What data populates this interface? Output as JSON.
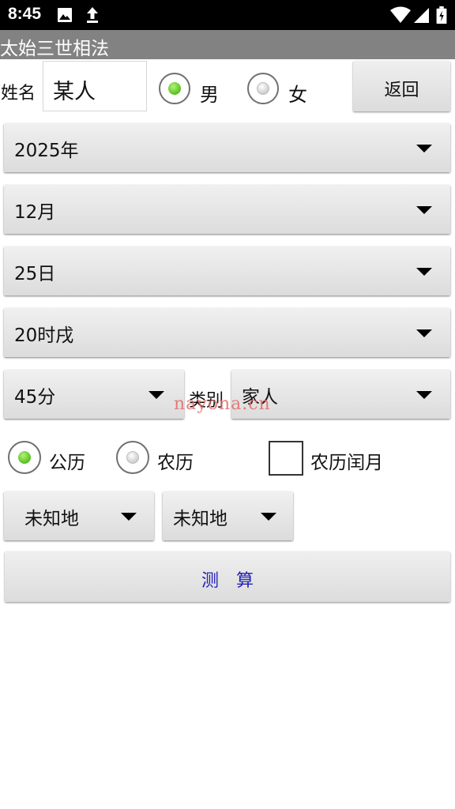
{
  "status_bar": {
    "time": "8:45",
    "left_icons": [
      "image-icon",
      "upload-icon"
    ],
    "right_icons": [
      "wifi-icon",
      "signal-icon",
      "battery-icon"
    ]
  },
  "app": {
    "title": "太始三世相法"
  },
  "form": {
    "name_label": "姓名",
    "name_value": "某人",
    "gender": {
      "male_label": "男",
      "female_label": "女",
      "selected": "男"
    },
    "back_button": "返回",
    "year": "2025年",
    "month": "12月",
    "day": "25日",
    "hour": "20时戌",
    "minute": "45分",
    "category_label": "类别",
    "category_value": "家人",
    "calendar": {
      "solar_label": "公历",
      "lunar_label": "农历",
      "selected": "公历"
    },
    "leap_month_label": "农历闰月",
    "leap_month_checked": false,
    "location_1": "未知地",
    "location_2": "未知地",
    "calculate_button": "测　算"
  },
  "watermark": "nayona.cn",
  "colors": {
    "title_bar": "#828282",
    "radio_selected": "#53c21d",
    "calculate_text": "#2323b8",
    "watermark": "#e26a6a"
  }
}
